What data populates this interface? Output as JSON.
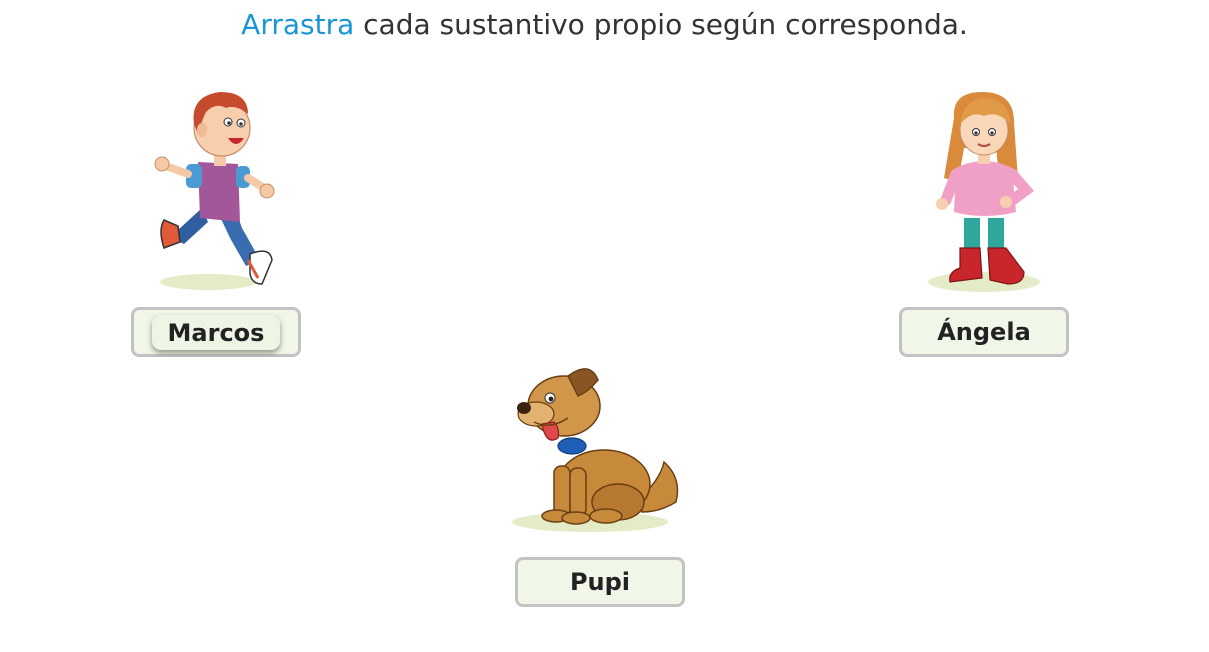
{
  "instruction": {
    "verb": "Arrastra",
    "rest": " cada sustantivo propio según corresponda."
  },
  "figures": {
    "boy": "running-boy-illustration",
    "girl": "standing-girl-illustration",
    "dog": "sitting-dog-illustration"
  },
  "dropzones": {
    "boy": {
      "chip_label": "Marcos"
    },
    "girl": {
      "label": "Ángela"
    },
    "dog": {
      "label": "Pupi"
    }
  }
}
